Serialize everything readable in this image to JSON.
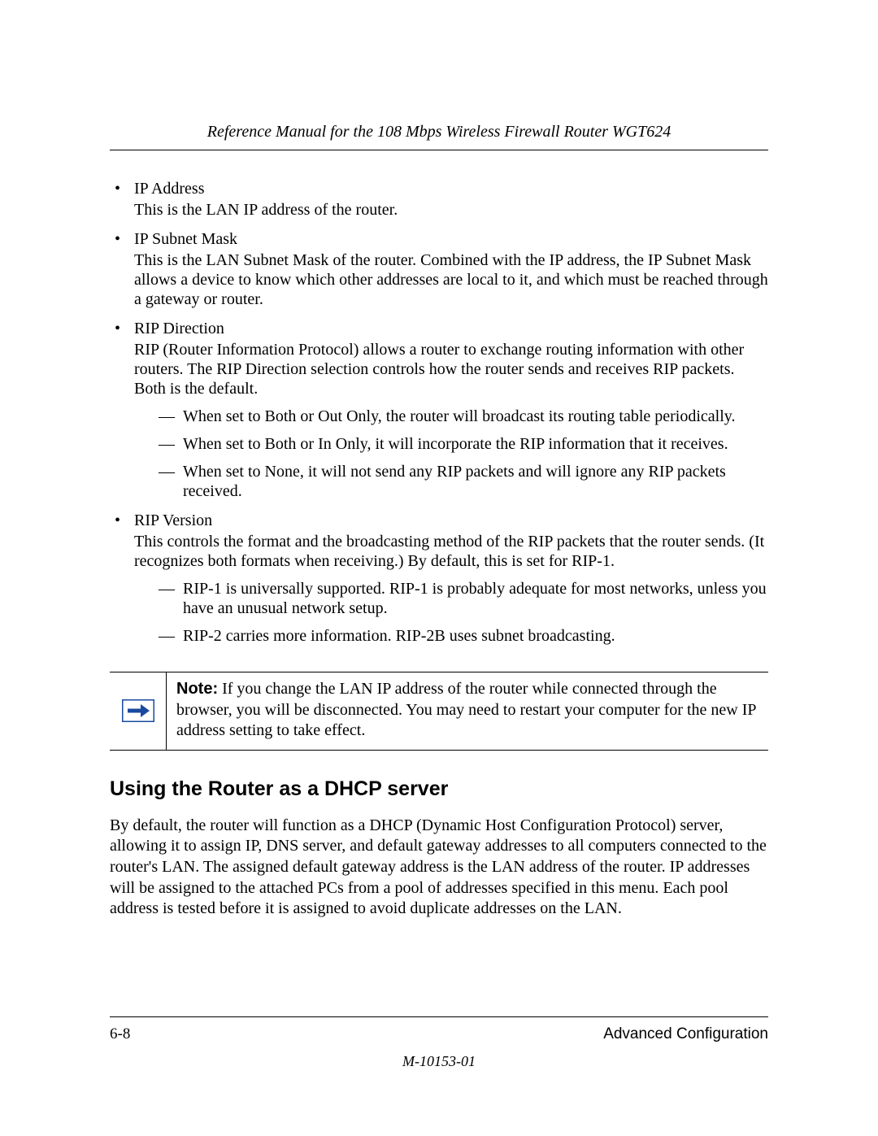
{
  "header": {
    "running_head": "Reference Manual for the 108 Mbps Wireless Firewall Router WGT624"
  },
  "bullets": [
    {
      "title": "IP Address",
      "desc": "This is the LAN IP address of the router.",
      "subs": []
    },
    {
      "title": "IP Subnet Mask",
      "desc": "This is the LAN Subnet Mask of the router. Combined with the IP address, the IP Subnet Mask allows a device to know which other addresses are local to it, and which must be reached through a gateway or router.",
      "subs": []
    },
    {
      "title": "RIP Direction",
      "desc": "RIP (Router Information Protocol) allows a router to exchange routing information with other routers. The RIP Direction selection controls how the router sends and receives RIP packets. Both is the default.",
      "subs": [
        "When set to Both or Out Only, the router will broadcast its routing table periodically.",
        "When set to Both or In Only, it will incorporate the RIP information that it receives.",
        "When set to None, it will not send any RIP packets and will ignore any RIP packets received."
      ]
    },
    {
      "title": "RIP Version",
      "desc": "This controls the format and the broadcasting method of the RIP packets that the router sends. (It recognizes both formats when receiving.) By default, this is set for RIP-1.",
      "subs": [
        "RIP-1 is universally supported. RIP-1 is probably adequate for most networks, unless you have an unusual network setup.",
        "RIP-2 carries more information. RIP-2B uses subnet broadcasting."
      ]
    }
  ],
  "note": {
    "label": "Note:",
    "text": " If you change the LAN IP address of the router while connected through the browser, you will be disconnected. You may need to restart your computer for the new IP address setting to take effect."
  },
  "section": {
    "heading": "Using the Router as a DHCP server",
    "body": "By default, the router will function as a DHCP (Dynamic Host Configuration Protocol) server, allowing it to assign IP, DNS server, and default gateway addresses to all computers connected to the router's LAN. The assigned default gateway address is the LAN address of the router. IP addresses will be assigned to the attached PCs from a pool of addresses specified in this menu. Each pool address is tested before it is assigned to avoid duplicate addresses on the LAN."
  },
  "footer": {
    "page_no": "6-8",
    "section_name": "Advanced Configuration",
    "doc_id": "M-10153-01"
  }
}
